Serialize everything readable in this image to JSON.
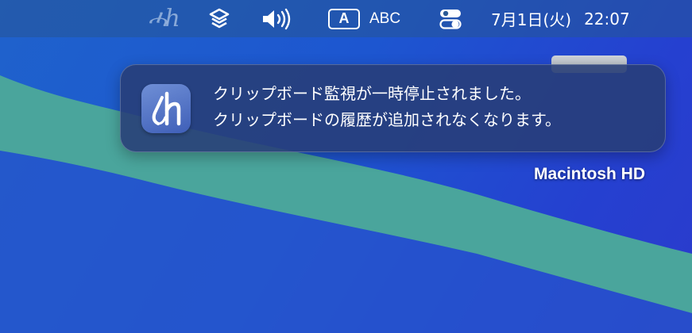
{
  "menubar": {
    "app_logo_text": "ሓh",
    "input_source_badge": "A",
    "input_source_name": "ABC",
    "clock": {
      "date": "7月1日(火)",
      "time": "22:07"
    },
    "icons": [
      "clipboard-app-logo-icon",
      "shortcuts-icon",
      "volume-icon",
      "input-source-icon",
      "control-center-icon"
    ]
  },
  "notification": {
    "line1": "クリップボード監視が一時停止されました。",
    "line2": "クリップボードの履歴が追加されなくなります。",
    "app_icon": "clipboard-app-icon"
  },
  "desktop": {
    "disk_label": "Macintosh HD"
  },
  "colors": {
    "wallpaper_blue": "#1f5fcc",
    "wallpaper_wave": "#4aa59c",
    "notification_bg": "#283e76"
  }
}
